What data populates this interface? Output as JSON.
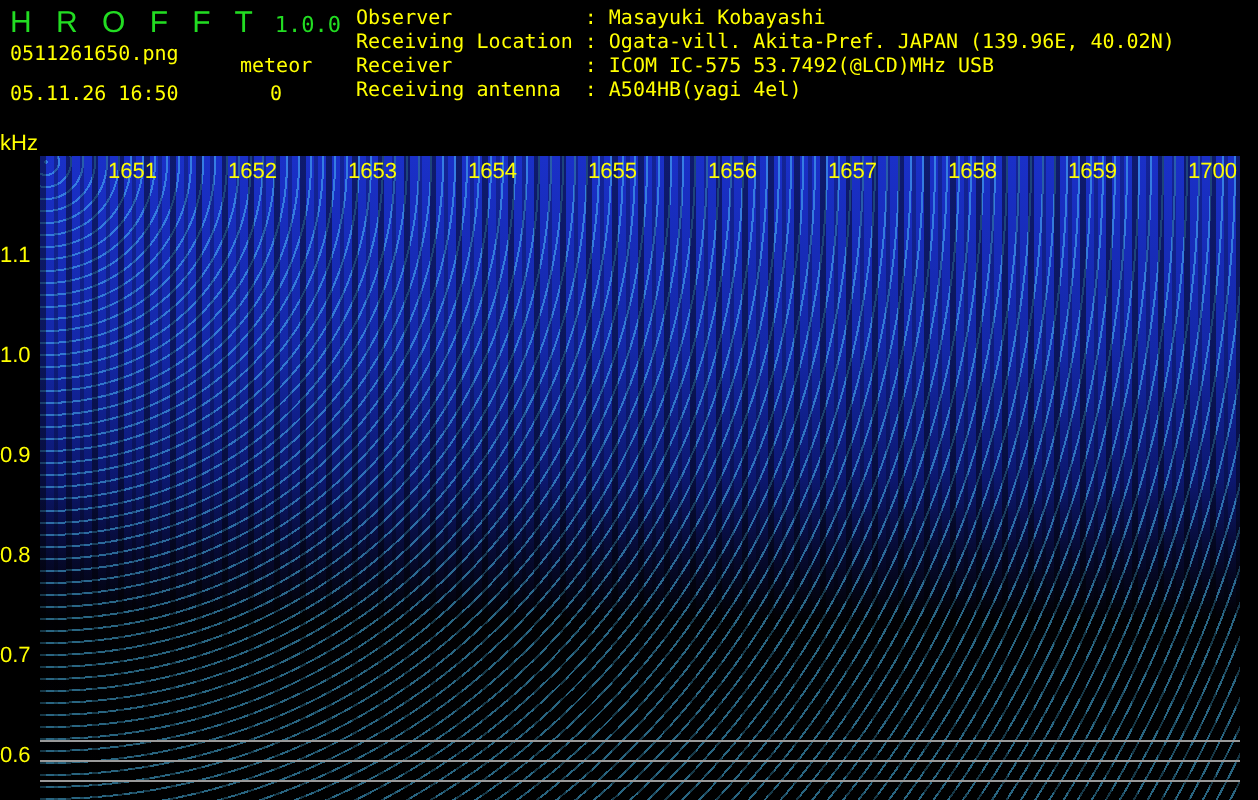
{
  "app": {
    "title": "H R O F F T",
    "version": "1.0.0"
  },
  "file": {
    "name": "0511261650.png",
    "datetime": "05.11.26 16:50"
  },
  "meteor": {
    "label": "meteor",
    "count": "0"
  },
  "info": [
    {
      "label": "Observer",
      "separator": ":",
      "value": "Masayuki Kobayashi"
    },
    {
      "label": "Receiving Location",
      "separator": ":",
      "value": "Ogata-vill. Akita-Pref. JAPAN (139.96E, 40.02N)"
    },
    {
      "label": "Receiver",
      "separator": ":",
      "value": "ICOM IC-575 53.7492(@LCD)MHz USB"
    },
    {
      "label": "Receiving antenna",
      "separator": ":",
      "value": "A504HB(yagi 4el)"
    }
  ],
  "spectrogram": {
    "unit": "kHz",
    "time_labels": [
      "1651",
      "1652",
      "1653",
      "1654",
      "1655",
      "1656",
      "1657",
      "1658",
      "1659",
      "1700"
    ],
    "freq_labels": [
      "1.1",
      "1.0",
      "0.9",
      "0.8",
      "0.7",
      "0.6"
    ]
  }
}
